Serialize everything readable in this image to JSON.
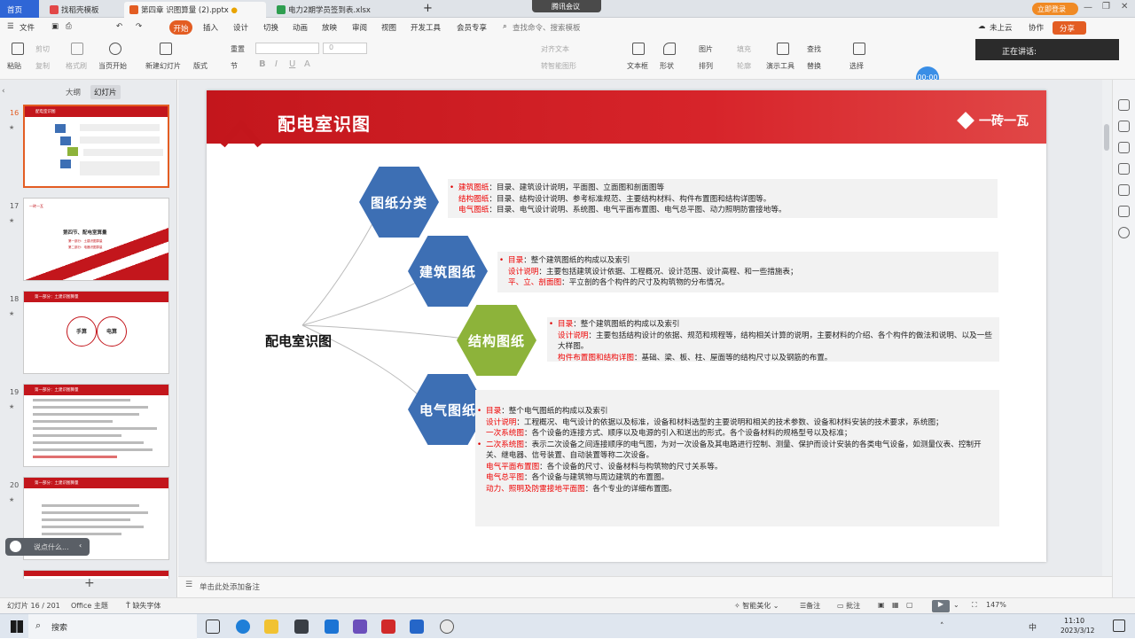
{
  "tabs": {
    "home": "首页",
    "tab1": "找稻壳模板",
    "tab2": "第四章 识图算量 (2).pptx",
    "tab3": "电力2期学员签到表.xlsx",
    "new_tab": "+",
    "login": "立即登录"
  },
  "meeting": "腾讯会议",
  "menu": {
    "file": "文件",
    "start": "开始",
    "items": [
      "插入",
      "设计",
      "切换",
      "动画",
      "放映",
      "审阅",
      "视图",
      "开发工具",
      "会员专享"
    ],
    "search": "查找命令、搜索模板",
    "unsaved": "未上云",
    "collab": "协作",
    "share": "分享"
  },
  "ribbon": {
    "paste": "粘贴",
    "cut": "剪切",
    "copy": "复制",
    "format_painter": "格式刷",
    "from_current": "当页开始",
    "new_slide": "新建幻灯片",
    "layout": "版式",
    "section": "节",
    "reset": "重置",
    "font_size": "0",
    "align_text": "对齐文本",
    "convert_smartart": "转智能图形",
    "textbox": "文本框",
    "shape": "形状",
    "picture": "图片",
    "fill": "填充",
    "arrange": "排列",
    "outline": "轮廓",
    "presenter": "演示工具",
    "find": "查找",
    "replace": "替换",
    "select": "选择"
  },
  "speaking": "正在讲话:",
  "timer": "00:00",
  "left_panel": {
    "tab_outline": "大纲",
    "tab_slides": "幻灯片",
    "thumbs": [
      {
        "num": "16",
        "title": "配电室识图"
      },
      {
        "num": "17",
        "title": "第四节、配电室算量"
      },
      {
        "num": "18",
        "title": "第一部分：土建识图算量"
      },
      {
        "num": "19",
        "title": "第一部分：土建识图算量"
      },
      {
        "num": "20",
        "title": "第一部分：土建识图算量"
      }
    ],
    "thumb17_brand": "一砖一瓦",
    "thumb17_sub1": "第一部分：土建识图算量",
    "thumb17_sub2": "第二部分：电器识图算量",
    "thumb18_a": "手算",
    "thumb18_b": "电算",
    "ask": "说点什么...",
    "add": "+"
  },
  "slide": {
    "title": "配电室识图",
    "brand": "一砖一瓦",
    "center": "配电室识图",
    "hex1": "图纸分类",
    "hex2": "建筑图纸",
    "hex3": "结构图纸",
    "hex4": "电气图纸",
    "b1": [
      {
        "k": "建筑图纸",
        "v": "：目录、建筑设计说明，平面图、立面图和剖面图等"
      },
      {
        "k": "结构图纸",
        "v": "：目录、结构设计说明、参考标准规范、主要结构材料、构件布置图和结构详图等。"
      },
      {
        "k": "电气图纸",
        "v": "：目录、电气设计说明、系统图、电气平面布置图、电气总平图、动力照明防雷接地等。"
      }
    ],
    "b2": [
      {
        "k": "目录",
        "v": "：整个建筑图纸的构成以及索引"
      },
      {
        "k": "设计说明",
        "v": "：主要包括建筑设计依据、工程概况、设计范围、设计高程、和一些措施表；"
      },
      {
        "k": "平、立、剖面图",
        "v": "：平立剖的各个构件的尺寸及构筑物的分布情况。"
      }
    ],
    "b3": [
      {
        "k": "目录",
        "v": "：整个建筑图纸的构成以及索引"
      },
      {
        "k": "设计说明",
        "v": "：主要包括结构设计的依据、规范和规程等，结构相关计算的说明，主要材料的介绍、各个构件的做法和说明、以及一些大样图。"
      },
      {
        "k": "构件布置图和结构详图",
        "v": "：基础、梁、板、柱、屋面等的结构尺寸以及钢筋的布置。"
      }
    ],
    "b4": [
      {
        "k": "目录",
        "v": "：整个电气图纸的构成以及索引"
      },
      {
        "k": "设计说明",
        "v": "：工程概况、电气设计的依据以及标准，设备和材料选型的主要说明和相关的技术参数、设备和材料安装的技术要求，系统图；"
      },
      {
        "k": "一次系统图",
        "v": "：各个设备的连接方式、顺序以及电源的引入和送出的形式。各个设备材料的规格型号以及标准；"
      },
      {
        "k": "二次系统图",
        "v": "：表示二次设备之间连接顺序的电气图，为对一次设备及其电路进行控制、测量、保护而设计安装的各类电气设备，如测量仪表、控制开关、继电器、信号装置、自动装置等称二次设备。"
      },
      {
        "k": "电气平面布置图",
        "v": "：各个设备的尺寸、设备材料与构筑物的尺寸关系等。"
      },
      {
        "k": "电气总平图",
        "v": "：各个设备与建筑物与周边建筑的布置图。"
      },
      {
        "k": "动力、照明及防雷接地平面图",
        "v": "：各个专业的详细布置图。"
      }
    ]
  },
  "notes": "单击此处添加备注",
  "status": {
    "slide_count": "幻灯片 16 / 201",
    "theme": "Office 主题",
    "missing_font": "缺失字体",
    "smart_beautify": "智能美化",
    "notes_btn": "备注",
    "comments_btn": "批注",
    "zoom": "147%"
  },
  "taskbar": {
    "search": "搜索",
    "time": "11:10",
    "date": "2023/3/12",
    "ime": "中"
  }
}
